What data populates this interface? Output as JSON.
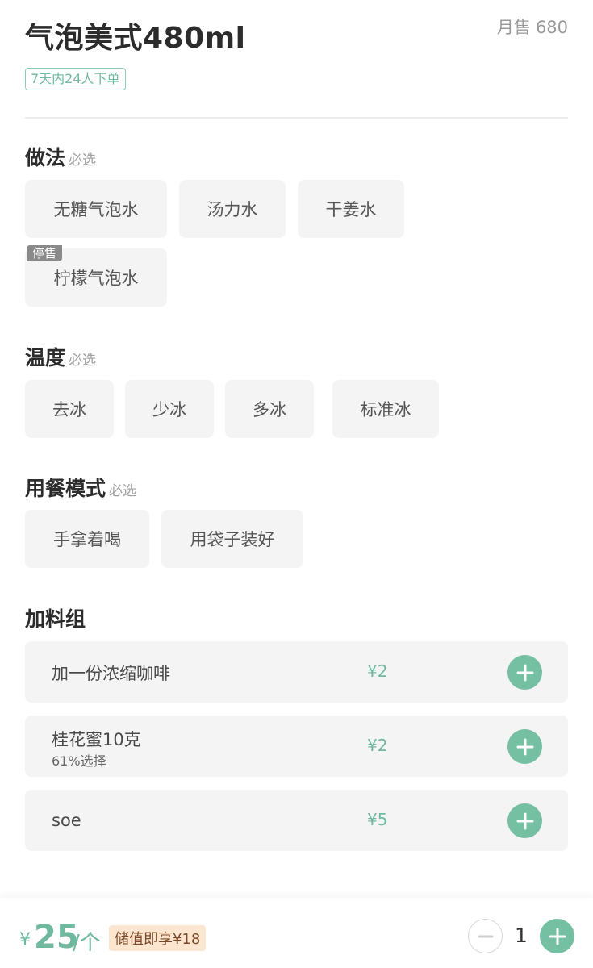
{
  "product": {
    "title": "气泡美式480ml",
    "monthly_sales_label": "月售",
    "monthly_sales_value": "680",
    "order_tag": "7天内24人下单"
  },
  "sections": {
    "method": {
      "title": "做法",
      "required": "必选",
      "options": [
        "无糖气泡水",
        "汤力水",
        "干姜水",
        "柠檬气泡水"
      ],
      "sold_out_badge": "停售"
    },
    "temperature": {
      "title": "温度",
      "required": "必选",
      "options": [
        "去冰",
        "少冰",
        "多冰",
        "标准冰"
      ]
    },
    "dining": {
      "title": "用餐模式",
      "required": "必选",
      "options": [
        "手拿着喝",
        "用袋子装好"
      ]
    },
    "toppings": {
      "title": "加料组",
      "items": [
        {
          "name": "加一份浓缩咖啡",
          "price": "¥2",
          "sub": ""
        },
        {
          "name": "桂花蜜10克",
          "price": "¥2",
          "sub": "61%选择"
        },
        {
          "name": "soe",
          "price": "¥5",
          "sub": ""
        }
      ]
    }
  },
  "footer": {
    "currency": "¥",
    "price": "25",
    "unit": "/个",
    "promo": "储值即享¥18",
    "quantity": "1"
  },
  "colors": {
    "accent": "#75bfa3",
    "accent_text": "#6fb99f",
    "promo_bg": "#fde6cf"
  },
  "icons": {
    "plus": "plus-icon",
    "minus": "minus-icon"
  }
}
